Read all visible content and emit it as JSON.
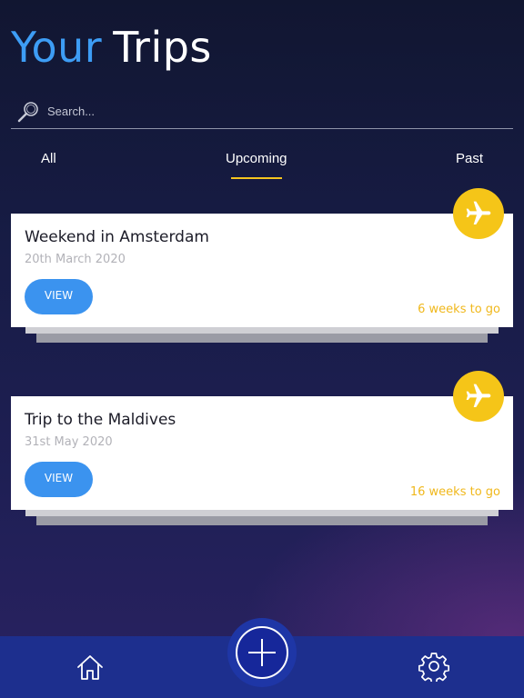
{
  "header": {
    "title_accent": "Your",
    "title_main": "Trips"
  },
  "search": {
    "placeholder": "Search...",
    "value": "",
    "icon": "search-icon"
  },
  "tabs": [
    {
      "label": "All",
      "selected": false
    },
    {
      "label": "Upcoming",
      "selected": true
    },
    {
      "label": "Past",
      "selected": false
    }
  ],
  "trips": [
    {
      "title": "Weekend in Amsterdam",
      "date": "20th March 2020",
      "button_label": "VIEW",
      "countdown": "6 weeks to go",
      "icon": "airplane-icon"
    },
    {
      "title": "Trip to the Maldives",
      "date": "31st May 2020",
      "button_label": "VIEW",
      "countdown": "16 weeks to go",
      "icon": "airplane-icon"
    }
  ],
  "bottom_nav": {
    "items": [
      "home-icon",
      "plus-icon",
      "gear-icon"
    ]
  },
  "colors": {
    "accent_blue": "#3d9df5",
    "button_blue": "#3b93ef",
    "accent_yellow": "#f5c518",
    "countdown_yellow": "#f0b81c",
    "nav_bar": "#1d2f8e"
  }
}
